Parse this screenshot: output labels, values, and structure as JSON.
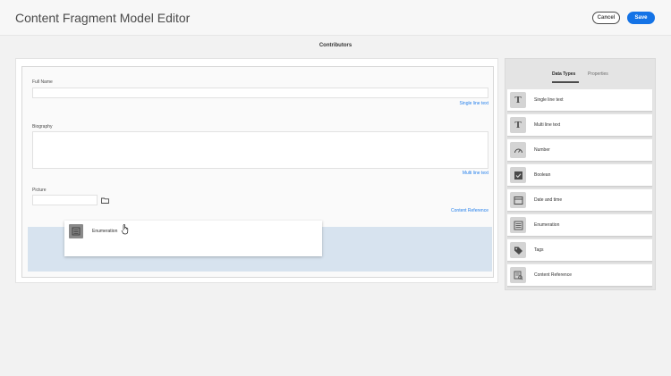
{
  "header": {
    "title": "Content Fragment Model Editor",
    "cancel_label": "Cancel",
    "save_label": "Save"
  },
  "model": {
    "title": "Contributors"
  },
  "form": {
    "fields": [
      {
        "label": "Full Name",
        "type_hint": "Single line text"
      },
      {
        "label": "Biography",
        "type_hint": "Multi line text"
      },
      {
        "label": "Picture",
        "type_hint": "Content Reference"
      }
    ],
    "dragging_item": {
      "label": "Enumeration",
      "icon": "enumeration-icon"
    }
  },
  "panel": {
    "tabs": [
      {
        "label": "Data Types",
        "active": true
      },
      {
        "label": "Properties",
        "active": false
      }
    ],
    "data_types": [
      {
        "label": "Single line text",
        "icon": "text-icon"
      },
      {
        "label": "Multi line text",
        "icon": "text-icon"
      },
      {
        "label": "Number",
        "icon": "gauge-icon"
      },
      {
        "label": "Boolean",
        "icon": "checkbox-icon"
      },
      {
        "label": "Date and time",
        "icon": "calendar-icon"
      },
      {
        "label": "Enumeration",
        "icon": "list-icon"
      },
      {
        "label": "Tags",
        "icon": "tag-icon"
      },
      {
        "label": "Content Reference",
        "icon": "content-reference-icon"
      }
    ]
  },
  "colors": {
    "accent": "#1473e6",
    "link": "#2680eb",
    "drop_zone": "#d7e3ef"
  }
}
